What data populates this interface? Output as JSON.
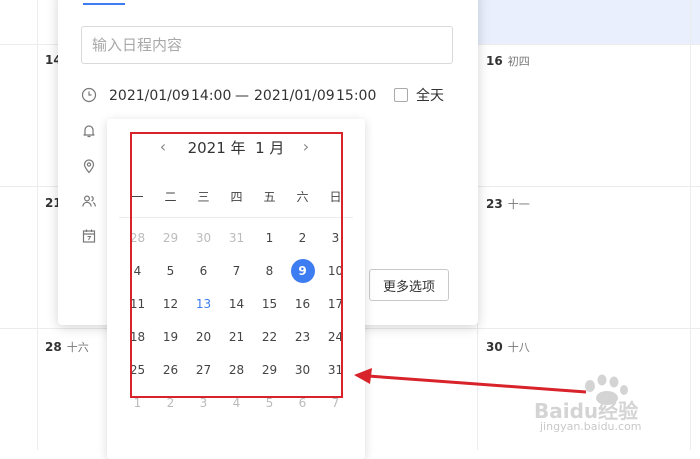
{
  "background_calendar": {
    "cells": [
      {
        "num": "14",
        "lunar": ""
      },
      {
        "num": "16",
        "lunar": "初四"
      },
      {
        "num": "21",
        "lunar": ""
      },
      {
        "num": "23",
        "lunar": "十一"
      },
      {
        "num": "28",
        "lunar": "十六"
      },
      {
        "num": "30",
        "lunar": "十八"
      }
    ]
  },
  "event_form": {
    "title_placeholder": "输入日程内容",
    "start_date": "2021/01/09",
    "start_time": "14:00",
    "separator": "—",
    "end_date": "2021/01/09",
    "end_time": "15:00",
    "all_day_label": "全天",
    "all_day_checked": false,
    "more_options_label": "更多选项"
  },
  "date_picker": {
    "year_label": "2021 年",
    "month_label": "1 月",
    "prev_symbol": "‹",
    "next_symbol": "›",
    "weekdays": [
      "一",
      "二",
      "三",
      "四",
      "五",
      "六",
      "日"
    ],
    "days": [
      {
        "d": "28",
        "s": "muted"
      },
      {
        "d": "29",
        "s": "muted"
      },
      {
        "d": "30",
        "s": "muted"
      },
      {
        "d": "31",
        "s": "muted"
      },
      {
        "d": "1",
        "s": ""
      },
      {
        "d": "2",
        "s": ""
      },
      {
        "d": "3",
        "s": ""
      },
      {
        "d": "4",
        "s": ""
      },
      {
        "d": "5",
        "s": ""
      },
      {
        "d": "6",
        "s": ""
      },
      {
        "d": "7",
        "s": ""
      },
      {
        "d": "8",
        "s": ""
      },
      {
        "d": "9",
        "s": "selected"
      },
      {
        "d": "10",
        "s": ""
      },
      {
        "d": "11",
        "s": ""
      },
      {
        "d": "12",
        "s": ""
      },
      {
        "d": "13",
        "s": "blue"
      },
      {
        "d": "14",
        "s": ""
      },
      {
        "d": "15",
        "s": ""
      },
      {
        "d": "16",
        "s": ""
      },
      {
        "d": "17",
        "s": ""
      },
      {
        "d": "18",
        "s": ""
      },
      {
        "d": "19",
        "s": ""
      },
      {
        "d": "20",
        "s": ""
      },
      {
        "d": "21",
        "s": ""
      },
      {
        "d": "22",
        "s": ""
      },
      {
        "d": "23",
        "s": ""
      },
      {
        "d": "24",
        "s": ""
      },
      {
        "d": "25",
        "s": ""
      },
      {
        "d": "26",
        "s": ""
      },
      {
        "d": "27",
        "s": ""
      },
      {
        "d": "28",
        "s": ""
      },
      {
        "d": "29",
        "s": ""
      },
      {
        "d": "30",
        "s": ""
      },
      {
        "d": "31",
        "s": ""
      },
      {
        "d": "1",
        "s": "muted"
      },
      {
        "d": "2",
        "s": "muted"
      },
      {
        "d": "3",
        "s": "muted"
      },
      {
        "d": "4",
        "s": "muted"
      },
      {
        "d": "5",
        "s": "muted"
      },
      {
        "d": "6",
        "s": "muted"
      },
      {
        "d": "7",
        "s": "muted"
      }
    ]
  },
  "watermark": {
    "brand": "Baidu经验",
    "url": "jingyan.baidu.com"
  },
  "colors": {
    "accent": "#3d7cf1",
    "annotation": "#d8232a",
    "highlight": "#e9effd"
  },
  "icons": [
    "clock-icon",
    "bell-icon",
    "location-icon",
    "people-icon",
    "calendar-icon"
  ]
}
